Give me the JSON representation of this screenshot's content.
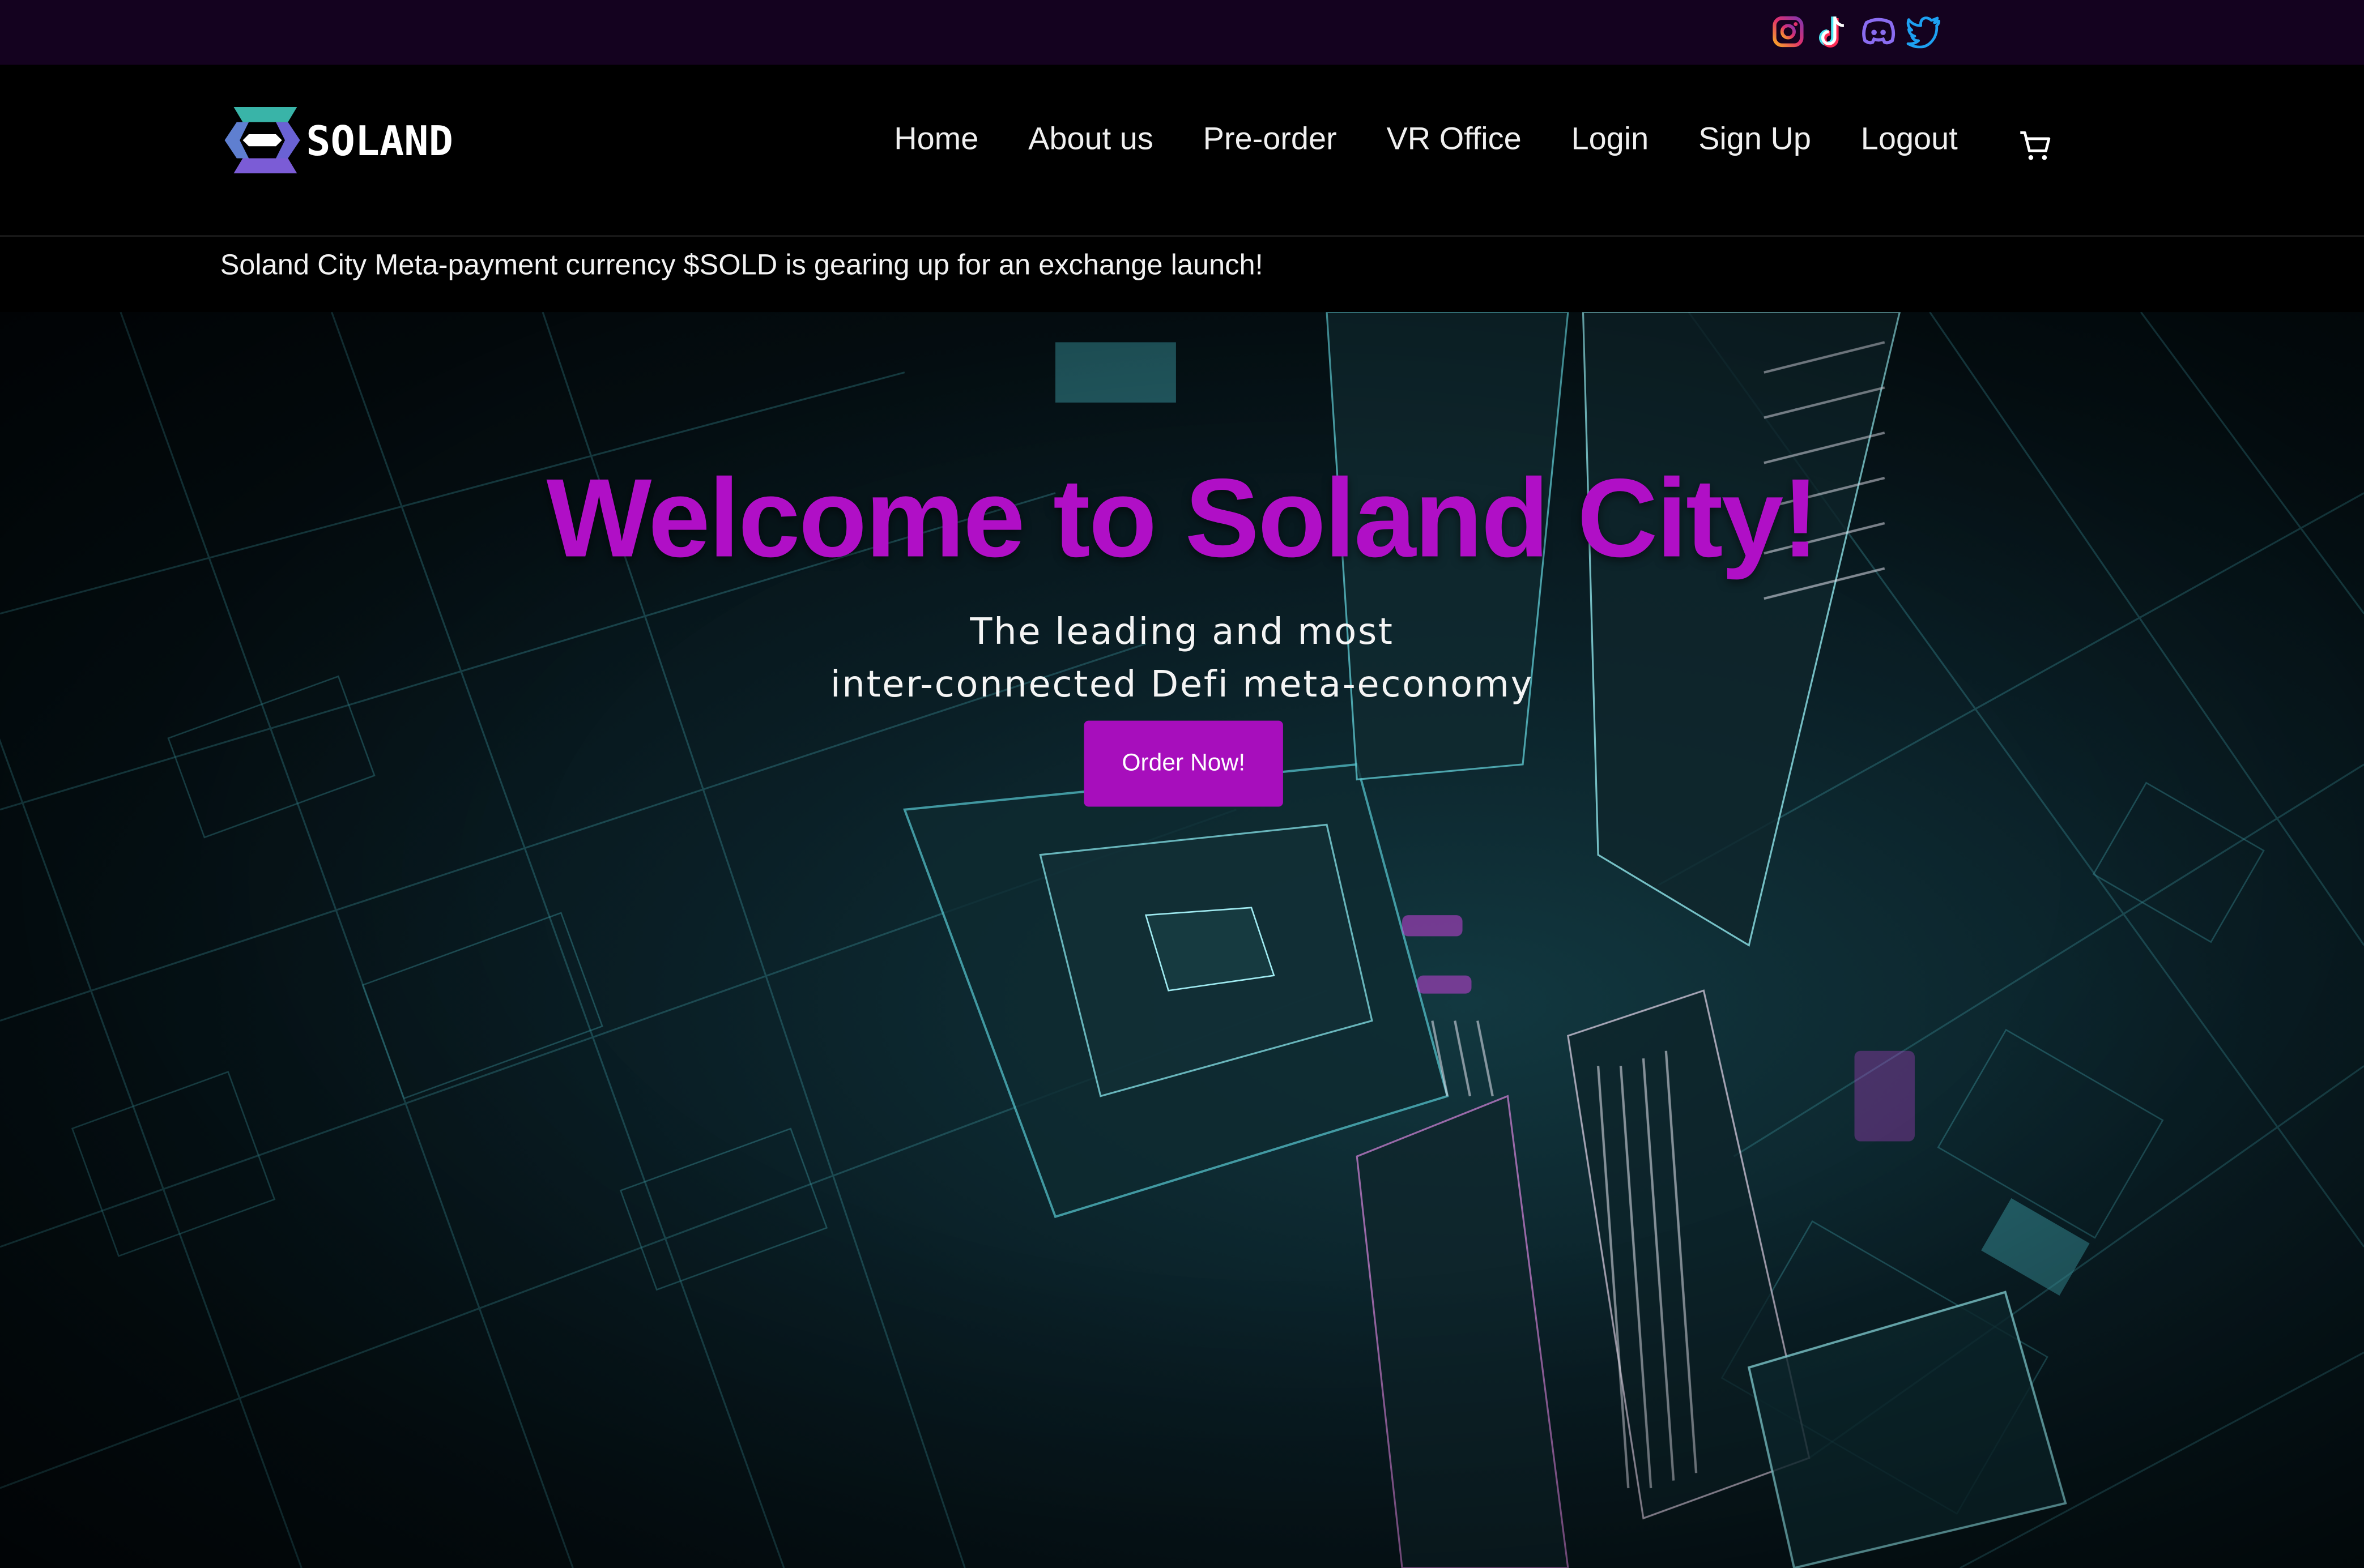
{
  "social": {
    "icons": [
      "instagram-icon",
      "tiktok-icon",
      "discord-icon",
      "twitter-icon"
    ],
    "colors": {
      "instagram": "#d62e8e",
      "tiktok": "#4de6f0",
      "discord": "#8a6cf0",
      "twitter": "#1da1f2"
    }
  },
  "brand": {
    "name": "SOLAND",
    "logo_colors": [
      "#7b5cd6",
      "#39b4a8"
    ]
  },
  "nav": {
    "items": [
      {
        "label": "Home"
      },
      {
        "label": "About us"
      },
      {
        "label": "Pre-order"
      },
      {
        "label": "VR Office"
      },
      {
        "label": "Login"
      },
      {
        "label": "Sign Up"
      },
      {
        "label": "Logout"
      }
    ],
    "cart_icon": "cart-icon"
  },
  "ticker": {
    "text": "Soland City Meta-payment currency $SOLD is gearing up for an exchange launch!"
  },
  "hero": {
    "title": "Welcome to Soland City!",
    "subtitle_line1": "The leading and most",
    "subtitle_line2": "inter-connected Defi meta-economy",
    "cta_label": "Order Now!",
    "accent_color": "#a70ebc"
  }
}
